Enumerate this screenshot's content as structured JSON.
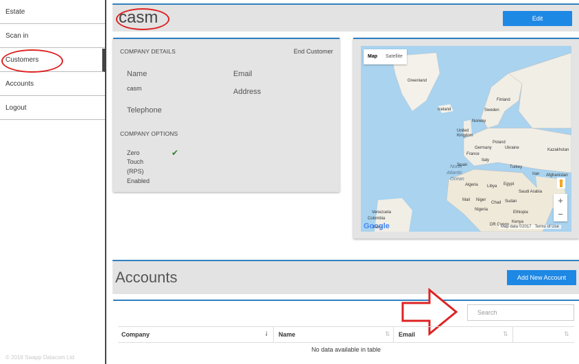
{
  "sidebar": {
    "items": [
      {
        "label": "Estate"
      },
      {
        "label": "Scan in"
      },
      {
        "label": "Customers"
      },
      {
        "label": "Accounts"
      },
      {
        "label": "Logout"
      }
    ],
    "footer": "© 2018 Swapp Datacom Ltd"
  },
  "company": {
    "title": "casm",
    "edit_label": "Edit"
  },
  "details": {
    "section_label": "COMPANY DETAILS",
    "type": "End Customer",
    "name_label": "Name",
    "name_value": "casm",
    "email_label": "Email",
    "address_label": "Address",
    "telephone_label": "Telephone",
    "options_label": "COMPANY OPTIONS",
    "option_line1": "Zero",
    "option_line2": "Touch",
    "option_line3": "(RPS)",
    "option_line4": "Enabled"
  },
  "map": {
    "tab_map": "Map",
    "tab_satellite": "Satellite",
    "attribution": "Map data ©2017",
    "terms": "Terms of Use",
    "logo": "Google",
    "places": [
      "Greenland",
      "Finland",
      "Sweden",
      "Iceland",
      "Norway",
      "United Kingdom",
      "Germany",
      "Poland",
      "Ukraine",
      "Kazakhstan",
      "France",
      "Italy",
      "Spain",
      "Turkey",
      "Afghanistan",
      "Iran",
      "Algeria",
      "Libya",
      "Egypt",
      "Saudi Arabia",
      "Mali",
      "Niger",
      "Chad",
      "Sudan",
      "Nigeria",
      "Ethiopia",
      "Kenya",
      "DR Congo",
      "Venezuela",
      "Colombia",
      "Peru",
      "North Atlantic Ocean"
    ]
  },
  "accounts": {
    "title": "Accounts",
    "add_label": "Add New Account",
    "search_placeholder": "Search",
    "columns": [
      "Company",
      "Name",
      "Email",
      ""
    ],
    "empty_message": "No data available in table"
  },
  "colors": {
    "accent": "#1e88e5",
    "panel": "#e3e3e3",
    "annotation": "#dd2222"
  }
}
